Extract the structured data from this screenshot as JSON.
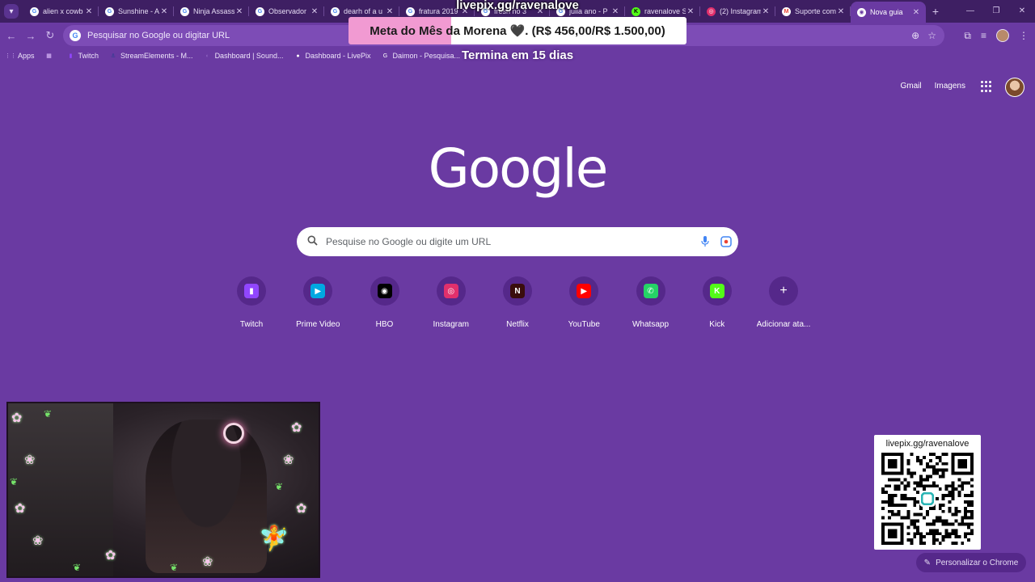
{
  "browser": {
    "tabs": [
      {
        "title": "alien x cowb",
        "favicon": "google",
        "color": "#ffffff",
        "fg": "#4285f4",
        "glyph": "G",
        "active": false
      },
      {
        "title": "Sunshine - A",
        "favicon": "google",
        "color": "#ffffff",
        "fg": "#4285f4",
        "glyph": "G",
        "active": false
      },
      {
        "title": "Ninja Assass",
        "favicon": "google",
        "color": "#ffffff",
        "fg": "#4285f4",
        "glyph": "G",
        "active": false
      },
      {
        "title": "Observador",
        "favicon": "google",
        "color": "#ffffff",
        "fg": "#4285f4",
        "glyph": "G",
        "active": false
      },
      {
        "title": "dearh of a u",
        "favicon": "google",
        "color": "#ffffff",
        "fg": "#4285f4",
        "glyph": "G",
        "active": false
      },
      {
        "title": "fratura 2019",
        "favicon": "google",
        "color": "#ffffff",
        "fg": "#4285f4",
        "glyph": "G",
        "active": false
      },
      {
        "title": "fresh no 3",
        "favicon": "google",
        "color": "#ffffff",
        "fg": "#4285f4",
        "glyph": "G",
        "active": false
      },
      {
        "title": "julia ano - P",
        "favicon": "google",
        "color": "#ffffff",
        "fg": "#4285f4",
        "glyph": "G",
        "active": false
      },
      {
        "title": "ravenalove S",
        "favicon": "kick",
        "color": "#53fc18",
        "fg": "#000000",
        "glyph": "K",
        "active": false
      },
      {
        "title": "(2) Instagram",
        "favicon": "instagram",
        "color": "#e1306c",
        "fg": "#ffffff",
        "glyph": "◎",
        "active": false
      },
      {
        "title": "Suporte com",
        "favicon": "gmail",
        "color": "#ffffff",
        "fg": "#ea4335",
        "glyph": "M",
        "active": false
      },
      {
        "title": "Nova guia",
        "favicon": "chrome",
        "color": "#ffffff",
        "fg": "#6a3aa2",
        "glyph": "◉",
        "active": true
      }
    ],
    "omnibox_text": "Pesquisar no Google ou digitar URL",
    "bookmarks": [
      {
        "label": "Apps",
        "icon": "apps-icon",
        "color": "#e0c0ff",
        "glyph": "⋮⋮"
      },
      {
        "label": "",
        "icon": "tab-groups-icon",
        "color": "#e0c0ff",
        "glyph": "▦"
      },
      {
        "label": "Twitch",
        "icon": "twitch-icon",
        "color": "#9146ff",
        "glyph": "▮"
      },
      {
        "label": "StreamElements - M...",
        "icon": "streamelements-icon",
        "color": "#2c3e8f",
        "glyph": "⚓"
      },
      {
        "label": "Dashboard | Sound...",
        "icon": "soundalerts-icon",
        "color": "#8a5fc0",
        "glyph": "◐"
      },
      {
        "label": "Dashboard - LivePix",
        "icon": "livepix-icon",
        "color": "#ffffff",
        "glyph": "●"
      },
      {
        "label": "Daimon - Pesquisa...",
        "icon": "google-icon",
        "color": "#ffffff",
        "glyph": "G"
      }
    ]
  },
  "overlay": {
    "url": "livepix.gg/ravenalove",
    "goal_text": "Meta do Mês da Morena 🖤. (R$ 456,00/R$ 1.500,00)",
    "goal_progress": 0.304,
    "goal_fill_color": "#f19ad2",
    "subtitle": "Termina em 15 dias"
  },
  "ntp": {
    "gmail": "Gmail",
    "images": "Imagens",
    "logo": "Google",
    "search_placeholder": "Pesquise no Google ou digite um URL",
    "shortcuts": [
      {
        "label": "Twitch",
        "icon": "twitch-icon",
        "bg": "#9146ff",
        "glyph": "▮"
      },
      {
        "label": "Prime Video",
        "icon": "prime-video-icon",
        "bg": "#00a8e1",
        "glyph": "▶"
      },
      {
        "label": "HBO",
        "icon": "hbo-icon",
        "bg": "#000000",
        "glyph": "◉"
      },
      {
        "label": "Instagram",
        "icon": "instagram-icon",
        "bg": "#e1306c",
        "glyph": "◎"
      },
      {
        "label": "Netflix",
        "icon": "netflix-icon",
        "bg": "#3a0d0d",
        "glyph": "N"
      },
      {
        "label": "YouTube",
        "icon": "youtube-icon",
        "bg": "#ff0000",
        "glyph": "▶"
      },
      {
        "label": "Whatsapp",
        "icon": "whatsapp-icon",
        "bg": "#25d366",
        "glyph": "✆"
      },
      {
        "label": "Kick",
        "icon": "kick-icon",
        "bg": "#53fc18",
        "glyph": "K"
      },
      {
        "label": "Adicionar ata...",
        "icon": "add-icon",
        "bg": "transparent",
        "glyph": "+"
      }
    ],
    "customize_label": "Personalizar o Chrome"
  },
  "qr": {
    "url": "livepix.gg/ravenalove"
  }
}
